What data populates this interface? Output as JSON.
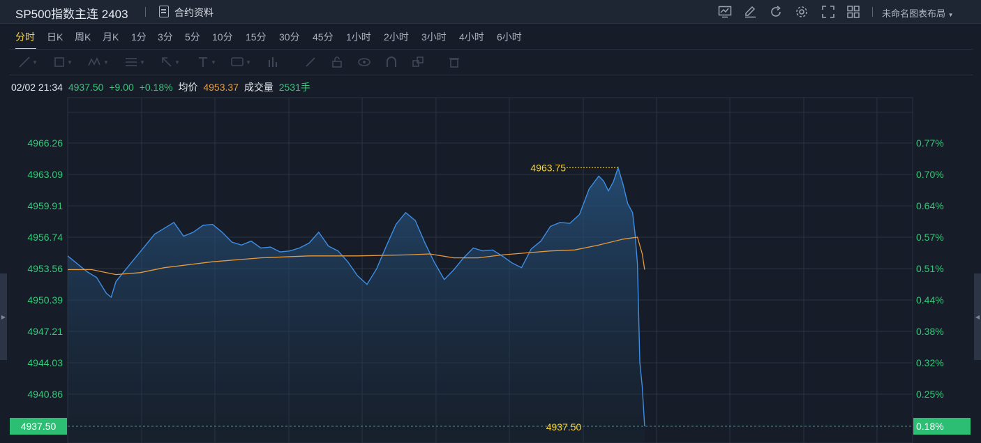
{
  "header": {
    "title": "SP500指数主连 2403",
    "doc_label": "合约资料",
    "layout_label": "未命名图表布局",
    "icons": [
      "chart-icon",
      "pencil-icon",
      "refresh-icon",
      "gear-icon",
      "fullscreen-icon",
      "grid-layout-icon"
    ]
  },
  "tabs": [
    "分时",
    "日K",
    "周K",
    "月K",
    "1分",
    "3分",
    "5分",
    "10分",
    "15分",
    "30分",
    "45分",
    "1小时",
    "2小时",
    "3小时",
    "4小时",
    "6小时"
  ],
  "active_tab": "分时",
  "draw_tools": [
    "line-tool-icon",
    "rect-tool-icon",
    "pattern-tool-icon",
    "fib-tool-icon",
    "arrow-tool-icon",
    "text-tool-icon",
    "label-tool-icon",
    "measure-tool-icon",
    "brush-icon",
    "lock-icon",
    "eye-icon",
    "magnet-icon",
    "link-icon",
    "trash-icon"
  ],
  "info": {
    "datetime": "02/02 21:34",
    "price": "4937.50",
    "change": "+9.00",
    "change_pct": "+0.18%",
    "avg_label": "均价",
    "avg_value": "4953.37",
    "volume_label": "成交量",
    "volume_value": "2531手"
  },
  "colors": {
    "up": "#35c878",
    "avg": "#e89a3c",
    "price_line": "#3d8ee6",
    "highlight": "#f6d23c"
  },
  "chart_data": {
    "type": "area",
    "y_ticks": [
      "4966.26",
      "4963.09",
      "4959.91",
      "4956.74",
      "4953.56",
      "4950.39",
      "4947.21",
      "4944.03",
      "4940.86"
    ],
    "pct_ticks": [
      "0.77%",
      "0.70%",
      "0.64%",
      "0.57%",
      "0.51%",
      "0.44%",
      "0.38%",
      "0.32%",
      "0.25%"
    ],
    "ylim": [
      4937.5,
      4968.5
    ],
    "last_price_label": "4937.50",
    "last_pct_label": "0.18%",
    "high_label": "4963.75",
    "high_value": 4963.75,
    "price_series": [
      [
        0.0,
        4954.8
      ],
      [
        0.02,
        4954.0
      ],
      [
        0.04,
        4953.2
      ],
      [
        0.06,
        4952.6
      ],
      [
        0.08,
        4951.0
      ],
      [
        0.09,
        4950.6
      ],
      [
        0.1,
        4952.2
      ],
      [
        0.12,
        4953.4
      ],
      [
        0.14,
        4954.6
      ],
      [
        0.16,
        4955.8
      ],
      [
        0.18,
        4957.0
      ],
      [
        0.2,
        4957.6
      ],
      [
        0.22,
        4958.2
      ],
      [
        0.24,
        4956.8
      ],
      [
        0.26,
        4957.2
      ],
      [
        0.28,
        4957.9
      ],
      [
        0.3,
        4958.0
      ],
      [
        0.32,
        4957.2
      ],
      [
        0.34,
        4956.2
      ],
      [
        0.36,
        4955.9
      ],
      [
        0.38,
        4956.3
      ],
      [
        0.4,
        4955.6
      ],
      [
        0.42,
        4955.7
      ],
      [
        0.44,
        4955.2
      ],
      [
        0.46,
        4955.3
      ],
      [
        0.48,
        4955.6
      ],
      [
        0.5,
        4956.1
      ],
      [
        0.52,
        4957.2
      ],
      [
        0.54,
        4955.8
      ],
      [
        0.56,
        4955.3
      ],
      [
        0.58,
        4954.2
      ],
      [
        0.6,
        4952.8
      ],
      [
        0.62,
        4951.9
      ],
      [
        0.64,
        4953.5
      ],
      [
        0.66,
        4955.8
      ],
      [
        0.68,
        4958.0
      ],
      [
        0.7,
        4959.2
      ],
      [
        0.72,
        4958.4
      ],
      [
        0.74,
        4956.1
      ],
      [
        0.76,
        4954.1
      ],
      [
        0.78,
        4952.4
      ],
      [
        0.8,
        4953.4
      ],
      [
        0.82,
        4954.6
      ],
      [
        0.84,
        4955.6
      ],
      [
        0.86,
        4955.3
      ],
      [
        0.88,
        4955.4
      ],
      [
        0.9,
        4954.8
      ],
      [
        0.92,
        4954.1
      ],
      [
        0.94,
        4953.6
      ],
      [
        0.96,
        4955.5
      ],
      [
        0.98,
        4956.3
      ],
      [
        1.0,
        4957.8
      ],
      [
        1.02,
        4958.2
      ],
      [
        1.04,
        4958.1
      ],
      [
        1.06,
        4959.0
      ],
      [
        1.08,
        4961.6
      ],
      [
        1.1,
        4962.9
      ],
      [
        1.11,
        4962.4
      ],
      [
        1.12,
        4961.4
      ],
      [
        1.13,
        4962.3
      ],
      [
        1.14,
        4963.75
      ],
      [
        1.15,
        4962.1
      ],
      [
        1.16,
        4960.1
      ],
      [
        1.17,
        4959.2
      ],
      [
        1.175,
        4957.1
      ],
      [
        1.18,
        4954.0
      ],
      [
        1.185,
        4944.0
      ],
      [
        1.19,
        4941.5
      ],
      [
        1.195,
        4937.5
      ]
    ],
    "avg_series": [
      [
        0.0,
        4953.4
      ],
      [
        0.05,
        4953.4
      ],
      [
        0.1,
        4952.9
      ],
      [
        0.15,
        4953.1
      ],
      [
        0.2,
        4953.6
      ],
      [
        0.3,
        4954.2
      ],
      [
        0.4,
        4954.6
      ],
      [
        0.5,
        4954.8
      ],
      [
        0.6,
        4954.8
      ],
      [
        0.7,
        4954.9
      ],
      [
        0.75,
        4955.0
      ],
      [
        0.8,
        4954.6
      ],
      [
        0.85,
        4954.6
      ],
      [
        0.9,
        4954.9
      ],
      [
        0.95,
        4955.1
      ],
      [
        1.0,
        4955.3
      ],
      [
        1.05,
        4955.4
      ],
      [
        1.1,
        4955.9
      ],
      [
        1.15,
        4956.5
      ],
      [
        1.18,
        4956.7
      ],
      [
        1.19,
        4955.0
      ],
      [
        1.195,
        4953.4
      ]
    ],
    "x_domain": [
      0,
      1.75
    ]
  }
}
